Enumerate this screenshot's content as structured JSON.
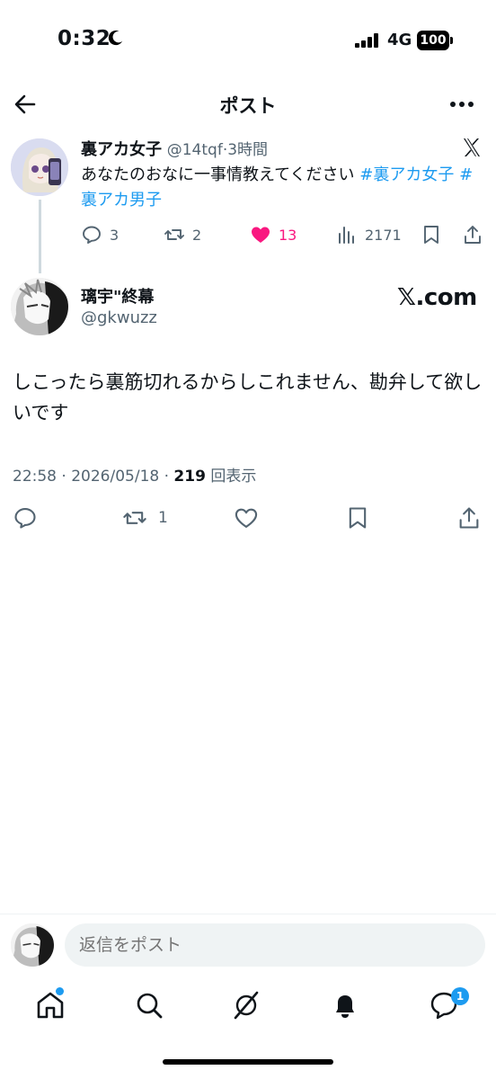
{
  "status_bar": {
    "time": "0:32",
    "network": "4G",
    "battery": "100"
  },
  "header": {
    "title": "ポスト"
  },
  "quoted_post": {
    "name": "裏アカ女子",
    "handle": "@14tqf",
    "time": "3時間",
    "text_plain": "あなたのおなに一事情教えてください ",
    "hashtags": [
      "#裏アカ女子",
      "#裏アカ男子"
    ],
    "replies": "3",
    "reposts": "2",
    "likes": "13",
    "views": "2171"
  },
  "main_post": {
    "name": "璃宇\"終幕",
    "handle": "@gkwuzz",
    "watermark": "𝕏.com",
    "text": "しこったら裏筋切れるからしこれません、勘弁して欲しいです",
    "time": "22:58",
    "date": "2026/05/18",
    "views_count": "219",
    "views_label": "回表示",
    "reposts": "1"
  },
  "reply": {
    "placeholder": "返信をポスト"
  },
  "tab_bar": {
    "messages_badge": "1"
  },
  "colors": {
    "accent": "#1d9bf0",
    "like": "#f91880",
    "muted": "#536471"
  }
}
